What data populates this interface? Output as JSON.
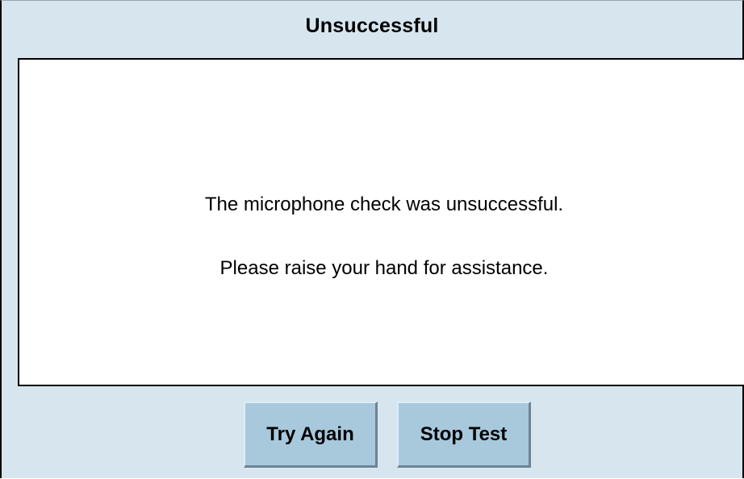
{
  "dialog": {
    "title": "Unsuccessful",
    "message": {
      "line1": "The microphone check was unsuccessful.",
      "line2": "Please raise your hand for assistance."
    },
    "buttons": {
      "try_again": "Try Again",
      "stop_test": "Stop Test"
    }
  },
  "colors": {
    "background": "#d7e5ee",
    "panel": "#ffffff",
    "button": "#a8c8dc",
    "text": "#000000"
  }
}
